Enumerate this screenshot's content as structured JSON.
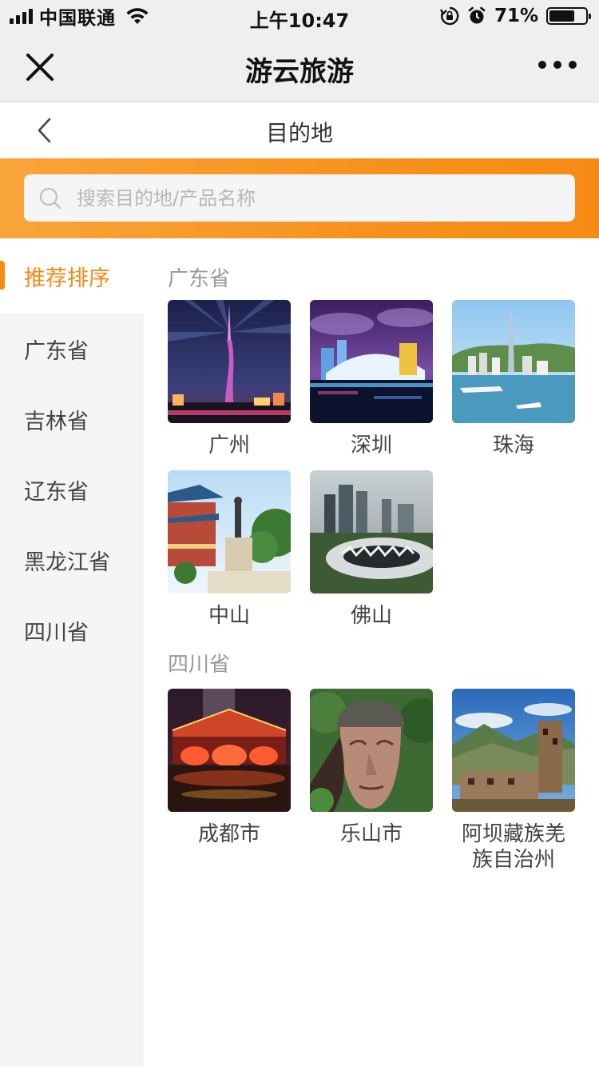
{
  "status_bar": {
    "carrier": "中国联通",
    "time": "上午10:47",
    "battery_percent": "71%",
    "battery_level": 0.71,
    "icons": [
      "signal-icon",
      "wifi-icon",
      "rotation-lock-icon",
      "alarm-icon",
      "battery-icon"
    ]
  },
  "app_bar": {
    "title": "游云旅游",
    "close_icon": "close-icon",
    "more_icon": "more-icon"
  },
  "page": {
    "title": "目的地",
    "back_icon": "chevron-left-icon"
  },
  "search": {
    "placeholder": "搜索目的地/产品名称",
    "value": ""
  },
  "sidebar": {
    "items": [
      {
        "label": "推荐排序",
        "active": true
      },
      {
        "label": "广东省",
        "active": false
      },
      {
        "label": "吉林省",
        "active": false
      },
      {
        "label": "辽东省",
        "active": false
      },
      {
        "label": "黑龙江省",
        "active": false
      },
      {
        "label": "四川省",
        "active": false
      }
    ]
  },
  "groups": [
    {
      "title": "广东省",
      "cities": [
        {
          "name": "广州",
          "photo": "canton-tower-night"
        },
        {
          "name": "深圳",
          "photo": "shenzhen-night-skyline"
        },
        {
          "name": "珠海",
          "photo": "zhuhai-coastline"
        },
        {
          "name": "中山",
          "photo": "sun-yat-sen-statue"
        },
        {
          "name": "佛山",
          "photo": "foshan-stadium-aerial"
        }
      ]
    },
    {
      "title": "四川省",
      "cities": [
        {
          "name": "成都市",
          "photo": "chengdu-bridge-night"
        },
        {
          "name": "乐山市",
          "photo": "leshan-giant-buddha"
        },
        {
          "name": "阿坝藏族羌族自治州",
          "photo": "aba-tibetan-village"
        }
      ]
    }
  ],
  "colors": {
    "accent": "#f38b14",
    "band_start": "#f9a53a",
    "band_end": "#f68a14",
    "sidebar_bg": "#f5f5f5",
    "group_title": "#999999"
  }
}
